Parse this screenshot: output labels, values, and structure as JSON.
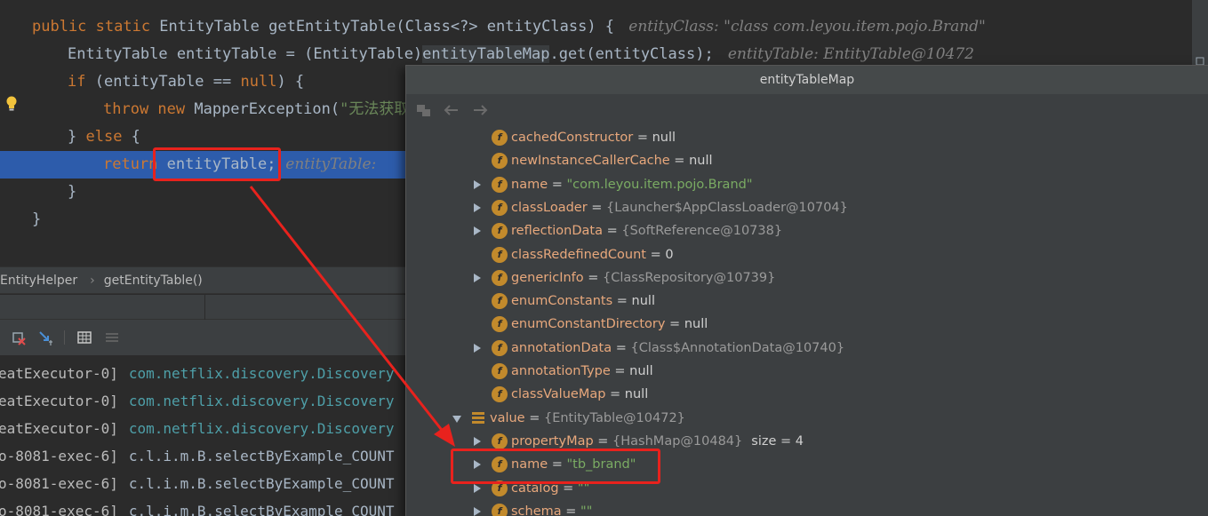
{
  "editor": {
    "lines": [
      {
        "indent": "  ",
        "parts": [
          {
            "t": "public static ",
            "c": "kw"
          },
          {
            "t": "EntityTable getEntityTable(Class<?> entityClass) {",
            "c": ""
          },
          {
            "t": "   entityClass: \"class com.leyou.item.pojo.Brand\"",
            "c": "inl"
          }
        ]
      },
      {
        "indent": "      ",
        "parts": [
          {
            "t": "EntityTable entityTable = (EntityTable)",
            "c": ""
          },
          {
            "t": "entityTableMap",
            "c": "hl"
          },
          {
            "t": ".get(entityClass);",
            "c": ""
          },
          {
            "t": "   entityTable: EntityTable@10472",
            "c": "inl"
          }
        ]
      },
      {
        "indent": "      ",
        "parts": [
          {
            "t": "if ",
            "c": "kw"
          },
          {
            "t": "(entityTable == ",
            "c": ""
          },
          {
            "t": "null",
            "c": "kw"
          },
          {
            "t": ") {",
            "c": ""
          }
        ]
      },
      {
        "indent": "          ",
        "parts": [
          {
            "t": "throw new ",
            "c": "kw"
          },
          {
            "t": "MapperException(",
            "c": ""
          },
          {
            "t": "\"无法获取",
            "c": "str"
          }
        ]
      },
      {
        "indent": "      ",
        "parts": [
          {
            "t": "} ",
            "c": ""
          },
          {
            "t": "else ",
            "c": "kw"
          },
          {
            "t": "{",
            "c": ""
          }
        ]
      },
      {
        "indent": "          ",
        "parts": [
          {
            "t": "return ",
            "c": "kw"
          },
          {
            "t": "entityTable;",
            "c": ""
          },
          {
            "t": "  entityTable:",
            "c": "inl"
          }
        ]
      },
      {
        "indent": "      ",
        "parts": [
          {
            "t": "}",
            "c": ""
          }
        ]
      },
      {
        "indent": "  ",
        "parts": [
          {
            "t": "}",
            "c": ""
          }
        ]
      }
    ]
  },
  "breadcrumb": {
    "class_name": "EntityHelper",
    "method_name": "getEntityTable()"
  },
  "console": {
    "lines": [
      {
        "thread": "eatExecutor-0]",
        "msg": "com.netflix.discovery.Discovery",
        "c": "con-pkg"
      },
      {
        "thread": "eatExecutor-0]",
        "msg": "com.netflix.discovery.Discovery",
        "c": "con-pkg"
      },
      {
        "thread": "eatExecutor-0]",
        "msg": "com.netflix.discovery.Discovery",
        "c": "con-pkg"
      },
      {
        "thread": "o-8081-exec-6]",
        "msg": "c.l.i.m.B.selectByExample_COUNT",
        "c": "con-plain"
      },
      {
        "thread": "o-8081-exec-6]",
        "msg": "c.l.i.m.B.selectByExample_COUNT",
        "c": "con-plain"
      },
      {
        "thread": "o-8081-exec-6]",
        "msg": "c.l.i.m.B.selectByExample_COUNT",
        "c": "con-plain"
      }
    ]
  },
  "popup": {
    "title": "entityTableMap",
    "rows": [
      {
        "name": "cachedConstructor",
        "value": "null",
        "kind": "val",
        "expand": "none",
        "level": 0
      },
      {
        "name": "newInstanceCallerCache",
        "value": "null",
        "kind": "val",
        "expand": "none",
        "level": 0
      },
      {
        "name": "name",
        "value": "\"com.leyou.item.pojo.Brand\"",
        "kind": "str",
        "expand": "right",
        "level": 0
      },
      {
        "name": "classLoader",
        "value": "{Launcher$AppClassLoader@10704}",
        "kind": "obj",
        "expand": "right",
        "level": 0
      },
      {
        "name": "reflectionData",
        "value": "{SoftReference@10738}",
        "kind": "obj",
        "expand": "right",
        "level": 0
      },
      {
        "name": "classRedefinedCount",
        "value": "0",
        "kind": "val",
        "expand": "none",
        "level": 0
      },
      {
        "name": "genericInfo",
        "value": "{ClassRepository@10739}",
        "kind": "obj",
        "expand": "right",
        "level": 0
      },
      {
        "name": "enumConstants",
        "value": "null",
        "kind": "val",
        "expand": "none",
        "level": 0
      },
      {
        "name": "enumConstantDirectory",
        "value": "null",
        "kind": "val",
        "expand": "none",
        "level": 0
      },
      {
        "name": "annotationData",
        "value": "{Class$AnnotationData@10740}",
        "kind": "obj",
        "expand": "right",
        "level": 0
      },
      {
        "name": "annotationType",
        "value": "null",
        "kind": "val",
        "expand": "none",
        "level": 0
      },
      {
        "name": "classValueMap",
        "value": "null",
        "kind": "val",
        "expand": "none",
        "level": 0
      },
      {
        "name": "value",
        "value": "{EntityTable@10472}",
        "kind": "obj",
        "expand": "down",
        "level": -1
      },
      {
        "name": "propertyMap",
        "value": "{HashMap@10484}",
        "extra": "size = 4",
        "kind": "obj",
        "expand": "right",
        "level": 0
      },
      {
        "name": "name",
        "value": "\"tb_brand\"",
        "kind": "str",
        "expand": "right",
        "level": 0
      },
      {
        "name": "catalog",
        "value": "\"\"",
        "kind": "str",
        "expand": "right",
        "level": 0
      },
      {
        "name": "schema",
        "value": "\"\"",
        "kind": "str",
        "expand": "right",
        "level": 0
      }
    ]
  },
  "colors": {
    "accent_red": "#e8221d",
    "field_icon": "#c28a2c",
    "exec_line": "#2d5cab"
  }
}
